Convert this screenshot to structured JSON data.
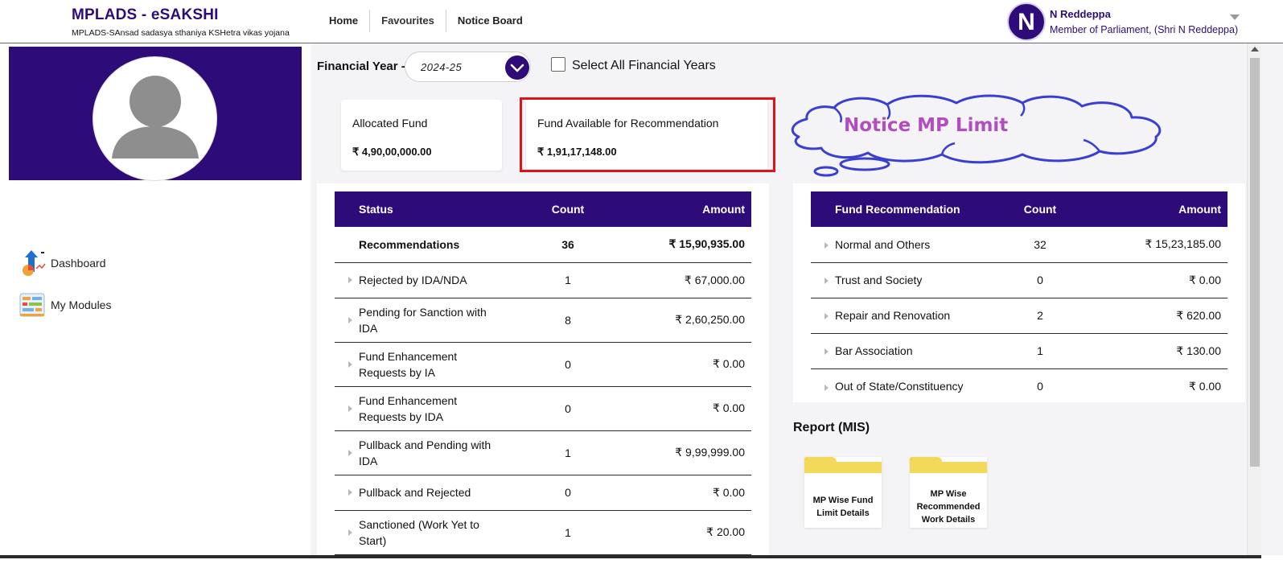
{
  "header": {
    "brand_title": "MPLADS - eSAKSHI",
    "brand_subtitle": "MPLADS-SAnsad sadasya sthaniya KSHetra vikas yojana",
    "nav": [
      "Home",
      "Favourites",
      "Notice Board"
    ],
    "user_initial": "N",
    "user_name": "N Reddeppa",
    "user_role": "Member of Parliament, (Shri N Reddeppa)"
  },
  "sidebar": {
    "profile_name": "N Reddeppa",
    "profile_role": "Member of Parliament",
    "items": [
      {
        "label": "Dashboard",
        "icon": "dashboard-icon"
      },
      {
        "label": "My Modules",
        "icon": "modules-icon"
      }
    ]
  },
  "filters": {
    "fy_label": "Financial Year -",
    "fy_value": "2024-25",
    "select_all_label": "Select All Financial Years",
    "select_all_checked": false
  },
  "cards": {
    "allocated_title": "Allocated Fund",
    "allocated_value": "₹ 4,90,00,000.00",
    "available_title": "Fund Available for Recommendation",
    "available_value": "₹ 1,91,17,148.00"
  },
  "annotation": {
    "cloud_text": "Notice MP Limit",
    "highlight_color": "#e0121a",
    "cloud_color": "#3b3fd0"
  },
  "status_table": {
    "headers": [
      "Status",
      "Count",
      "Amount"
    ],
    "rows": [
      {
        "label": "Recommendations",
        "count": "36",
        "amount": "₹ 15,90,935.00",
        "bold": true
      },
      {
        "label": "Rejected by IDA/NDA",
        "count": "1",
        "amount": "₹ 67,000.00"
      },
      {
        "label": "Pending for Sanction with IDA",
        "count": "8",
        "amount": "₹ 2,60,250.00"
      },
      {
        "label": "Fund Enhancement Requests by IA",
        "count": "0",
        "amount": "₹ 0.00"
      },
      {
        "label": "Fund Enhancement Requests by IDA",
        "count": "0",
        "amount": "₹ 0.00"
      },
      {
        "label": "Pullback and Pending with IDA",
        "count": "1",
        "amount": "₹ 9,99,999.00"
      },
      {
        "label": "Pullback and Rejected",
        "count": "0",
        "amount": "₹ 0.00"
      },
      {
        "label": "Sanctioned (Work Yet to Start)",
        "count": "1",
        "amount": "₹ 20.00"
      }
    ]
  },
  "fund_table": {
    "headers": [
      "Fund Recommendation",
      "Count",
      "Amount"
    ],
    "rows": [
      {
        "label": "Normal and Others",
        "count": "32",
        "amount": "₹ 15,23,185.00"
      },
      {
        "label": "Trust and Society",
        "count": "0",
        "amount": "₹ 0.00"
      },
      {
        "label": "Repair and Renovation",
        "count": "2",
        "amount": "₹ 620.00"
      },
      {
        "label": "Bar Association",
        "count": "1",
        "amount": "₹ 130.00"
      },
      {
        "label": "Out of State/Constituency",
        "count": "0",
        "amount": "₹ 0.00"
      }
    ]
  },
  "reports": {
    "title": "Report (MIS)",
    "items": [
      {
        "label": "MP Wise Fund Limit Details"
      },
      {
        "label": "MP Wise Recommended Work Details"
      }
    ]
  },
  "colors": {
    "brand": "#2d0c7a",
    "folder": "#f3d95a"
  }
}
